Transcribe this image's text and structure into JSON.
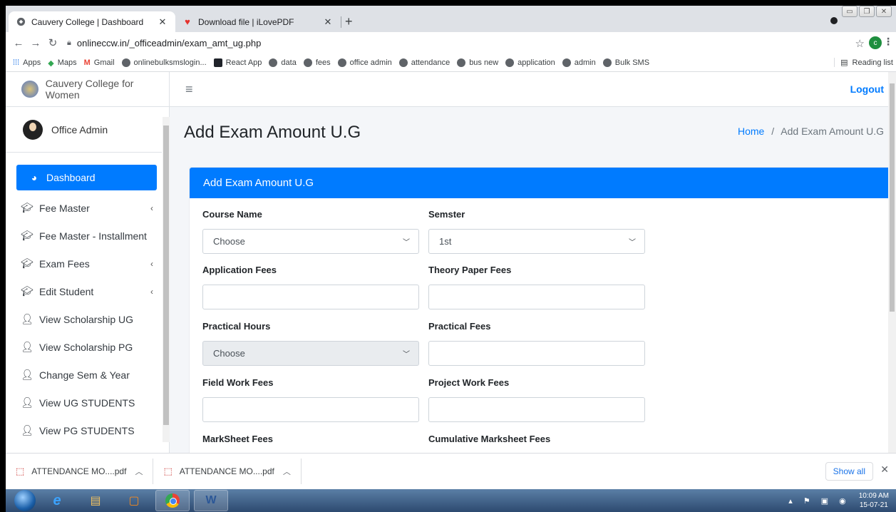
{
  "browser": {
    "tabs": [
      {
        "title": "Cauvery College | Dashboard",
        "active": true,
        "icon": "globe-icon"
      },
      {
        "title": "Download file | iLovePDF",
        "active": false,
        "icon": "heart-icon"
      }
    ],
    "new_tab": "+",
    "url": "onlineccw.in/_officeadmin/exam_amt_ug.php",
    "profile_initial": "c",
    "bookmarks": [
      "Apps",
      "Maps",
      "Gmail",
      "onlinebulksmslogin...",
      "React App",
      "data",
      "fees",
      "office admin",
      "attendance",
      "bus new",
      "application",
      "admin",
      "Bulk SMS"
    ],
    "reading_list": "Reading list"
  },
  "sidebar": {
    "brand": "Cauvery College for Women",
    "user": "Office Admin",
    "items": [
      {
        "label": "Dashboard",
        "icon": "dashboard-icon",
        "active": true,
        "caret": ""
      },
      {
        "label": "Fee Master",
        "icon": "graduation-cap-icon",
        "active": false,
        "caret": "‹"
      },
      {
        "label": "Fee Master - Installment",
        "icon": "graduation-cap-icon",
        "active": false,
        "caret": ""
      },
      {
        "label": "Exam Fees",
        "icon": "graduation-cap-icon",
        "active": false,
        "caret": "‹"
      },
      {
        "label": "Edit Student",
        "icon": "graduation-cap-icon",
        "active": false,
        "caret": "‹"
      },
      {
        "label": "View Scholarship UG",
        "icon": "user-plus-icon",
        "active": false,
        "caret": ""
      },
      {
        "label": "View Scholarship PG",
        "icon": "user-plus-icon",
        "active": false,
        "caret": ""
      },
      {
        "label": "Change Sem & Year",
        "icon": "user-plus-icon",
        "active": false,
        "caret": ""
      },
      {
        "label": "View UG STUDENTS",
        "icon": "user-plus-icon",
        "active": false,
        "caret": ""
      },
      {
        "label": "View PG STUDENTS",
        "icon": "user-plus-icon",
        "active": false,
        "caret": ""
      }
    ]
  },
  "header": {
    "logout": "Logout",
    "page_title": "Add Exam Amount U.G",
    "breadcrumb_home": "Home",
    "breadcrumb_sep": "/",
    "breadcrumb_current": "Add Exam Amount U.G"
  },
  "card": {
    "title": "Add Exam Amount U.G",
    "fields": {
      "course_name": {
        "label": "Course Name",
        "value": "Choose"
      },
      "semester": {
        "label": "Semster",
        "value": "1st"
      },
      "application_fees": {
        "label": "Application Fees",
        "value": ""
      },
      "theory_paper_fees": {
        "label": "Theory Paper Fees",
        "value": ""
      },
      "practical_hours": {
        "label": "Practical Hours",
        "value": "Choose"
      },
      "practical_fees": {
        "label": "Practical Fees",
        "value": ""
      },
      "field_work_fees": {
        "label": "Field Work Fees",
        "value": ""
      },
      "project_work_fees": {
        "label": "Project Work Fees",
        "value": ""
      },
      "marksheet_fees": {
        "label": "MarkSheet Fees"
      },
      "cumulative_marksheet_fees": {
        "label": "Cumulative Marksheet Fees"
      }
    }
  },
  "downloads": {
    "items": [
      "ATTENDANCE MO....pdf",
      "ATTENDANCE MO....pdf"
    ],
    "show_all": "Show all"
  },
  "taskbar": {
    "time": "10:09 AM",
    "date": "15-07-21"
  },
  "colors": {
    "primary": "#007bff",
    "sidebar_bg": "#ffffff",
    "content_bg": "#f4f6f9",
    "taskbar": "#2d4a70"
  }
}
